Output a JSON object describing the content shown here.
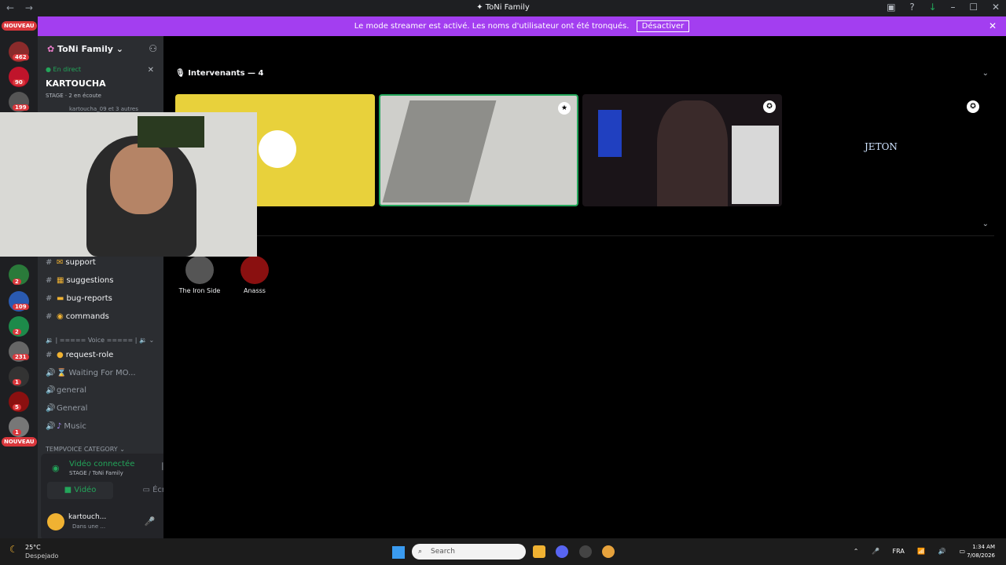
{
  "window": {
    "title": "ToNi Family"
  },
  "banner": {
    "text": "Le mode streamer est activé. Les noms d'utilisateur ont été tronqués.",
    "button": "Désactiver"
  },
  "rail": {
    "badges": [
      "462",
      "90",
      "199",
      "2",
      "109",
      "2",
      "231",
      "1",
      "5",
      "1"
    ],
    "new_label": "NOUVEAU"
  },
  "guild": {
    "name": "ToNi Family"
  },
  "stage": {
    "live_label": "En direct",
    "title": "KARTOUCHA",
    "meta": "STAGE · 2 en écoute",
    "more": "kartoucha_09 et 3 autres"
  },
  "channels": [
    {
      "name": "support",
      "emoji": "✉"
    },
    {
      "name": "suggestions",
      "emoji": "▦"
    },
    {
      "name": "bug-reports",
      "emoji": "▬"
    },
    {
      "name": "commands",
      "emoji": "◉"
    }
  ],
  "voice_category": "| ===== Voice ===== |",
  "request_role": "request-role",
  "voice_channels": [
    {
      "name": "Waiting For MO..."
    },
    {
      "name": "general"
    },
    {
      "name": "General"
    },
    {
      "name": "Music"
    }
  ],
  "temp_category": "TEMPVOICE CATEGORY",
  "voice_status": {
    "status": "Vidéo connectée",
    "sub": "STAGE / ToNi Family",
    "video_btn": "Vidéo",
    "screen_btn": "Écran"
  },
  "user": {
    "name": "kartouch...",
    "status": "Dans une ..."
  },
  "main": {
    "speakers_title": "Intervenants — 4",
    "audience": [
      {
        "name": "The Iron Side"
      },
      {
        "name": "Anasss"
      }
    ],
    "tile4_text": "JETON"
  },
  "taskbar": {
    "temp": "25°C",
    "weather": "Despejado",
    "search": "Search",
    "lang": "FRA",
    "time": "1:34 AM",
    "date": "7/08/2026"
  },
  "colors": {
    "banner": "#a33ef0",
    "online": "#23a55a",
    "badge": "#da373c",
    "tile_yellow": "#e8d13b"
  }
}
